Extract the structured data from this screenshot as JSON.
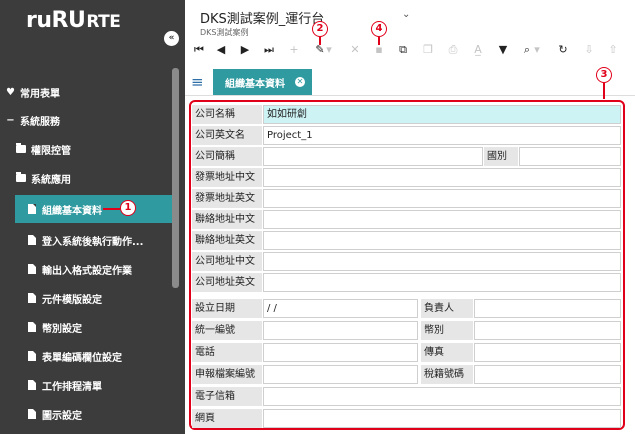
{
  "app": {
    "logo_main": "ruRU",
    "logo_sub": "RTE",
    "collapse_glyph": "«"
  },
  "header": {
    "title": "DKS測試案例_運行台",
    "subtitle": "DKS測試案例",
    "caret": "⌄"
  },
  "sidebar": {
    "items": [
      {
        "label": "常用表單",
        "icon": "♥",
        "kind": "section"
      },
      {
        "label": "系統服務",
        "icon": "−",
        "kind": "section"
      },
      {
        "label": "權限控管",
        "kind": "folder"
      },
      {
        "label": "系統應用",
        "kind": "folder"
      },
      {
        "label": "組織基本資料",
        "kind": "file",
        "active": true
      },
      {
        "label": "登入系統後執行動作...",
        "kind": "file"
      },
      {
        "label": "輸出入格式設定作業",
        "kind": "file"
      },
      {
        "label": "元件模版設定",
        "kind": "file"
      },
      {
        "label": "幣別設定",
        "kind": "file"
      },
      {
        "label": "表單編碼欄位設定",
        "kind": "file"
      },
      {
        "label": "工作排程清單",
        "kind": "file"
      },
      {
        "label": "圖示設定",
        "kind": "file"
      }
    ]
  },
  "toolbar": {
    "buttons": [
      {
        "name": "first-record-icon",
        "glyph": "⏮",
        "disabled": false
      },
      {
        "name": "prev-record-icon",
        "glyph": "◀",
        "disabled": false
      },
      {
        "name": "next-record-icon",
        "glyph": "▶",
        "disabled": false
      },
      {
        "name": "last-record-icon",
        "glyph": "⏭",
        "disabled": false
      },
      {
        "name": "add-icon",
        "glyph": "+",
        "disabled": true
      },
      {
        "name": "edit-pencil-icon",
        "glyph": "✎",
        "disabled": false
      },
      {
        "name": "edit-caret-icon",
        "glyph": "▾",
        "disabled": true
      },
      {
        "name": "delete-icon",
        "glyph": "✕",
        "disabled": true
      },
      {
        "name": "save-icon",
        "glyph": "▪",
        "disabled": true
      },
      {
        "name": "open-external-icon",
        "glyph": "⧉",
        "disabled": false
      },
      {
        "name": "copy-icon",
        "glyph": "❐",
        "disabled": true
      },
      {
        "name": "print-icon",
        "glyph": "⎙",
        "disabled": true
      },
      {
        "name": "translate-icon",
        "glyph": "A̲",
        "disabled": true
      },
      {
        "name": "filter-icon",
        "glyph": "▼",
        "disabled": false
      },
      {
        "name": "search-icon",
        "glyph": "⌕",
        "disabled": false
      },
      {
        "name": "search-caret-icon",
        "glyph": "▾",
        "disabled": true
      },
      {
        "name": "refresh-icon",
        "glyph": "↻",
        "disabled": false
      },
      {
        "name": "import-icon",
        "glyph": "⇩",
        "disabled": true
      },
      {
        "name": "export-icon",
        "glyph": "⇧",
        "disabled": true
      }
    ]
  },
  "tab": {
    "label": "組織基本資料",
    "close_glyph": "✕"
  },
  "hamburger_glyph": "≡",
  "form": {
    "company_name": {
      "label": "公司名稱",
      "value": "如如研創"
    },
    "company_name_en": {
      "label": "公司英文名",
      "value": "Project_1"
    },
    "company_short": {
      "label": "公司簡稱",
      "value": ""
    },
    "country": {
      "label": "國別",
      "value": ""
    },
    "invoice_addr_cn": {
      "label": "發票地址中文",
      "value": ""
    },
    "invoice_addr_en": {
      "label": "發票地址英文",
      "value": ""
    },
    "contact_addr_cn": {
      "label": "聯絡地址中文",
      "value": ""
    },
    "contact_addr_en": {
      "label": "聯絡地址英文",
      "value": ""
    },
    "company_addr_cn": {
      "label": "公司地址中文",
      "value": ""
    },
    "company_addr_en": {
      "label": "公司地址英文",
      "value": ""
    },
    "established": {
      "label": "設立日期",
      "value": "/ /"
    },
    "owner": {
      "label": "負責人",
      "value": ""
    },
    "tax_id": {
      "label": "統一編號",
      "value": ""
    },
    "currency": {
      "label": "幣別",
      "value": ""
    },
    "phone": {
      "label": "電話",
      "value": ""
    },
    "fax": {
      "label": "傳真",
      "value": ""
    },
    "filing_no": {
      "label": "申報檔案編號",
      "value": ""
    },
    "tax_reg_no": {
      "label": "稅籍號碼",
      "value": ""
    },
    "email": {
      "label": "電子信箱",
      "value": ""
    },
    "website": {
      "label": "網頁",
      "value": ""
    }
  },
  "annotations": {
    "a1": "1",
    "a2": "2",
    "a3": "3",
    "a4": "4"
  },
  "colors": {
    "accent": "#2f9a9f",
    "sidebar_bg": "#3c3c3c",
    "annotation": "#e1001a",
    "highlight_field": "#cdf3f5"
  }
}
